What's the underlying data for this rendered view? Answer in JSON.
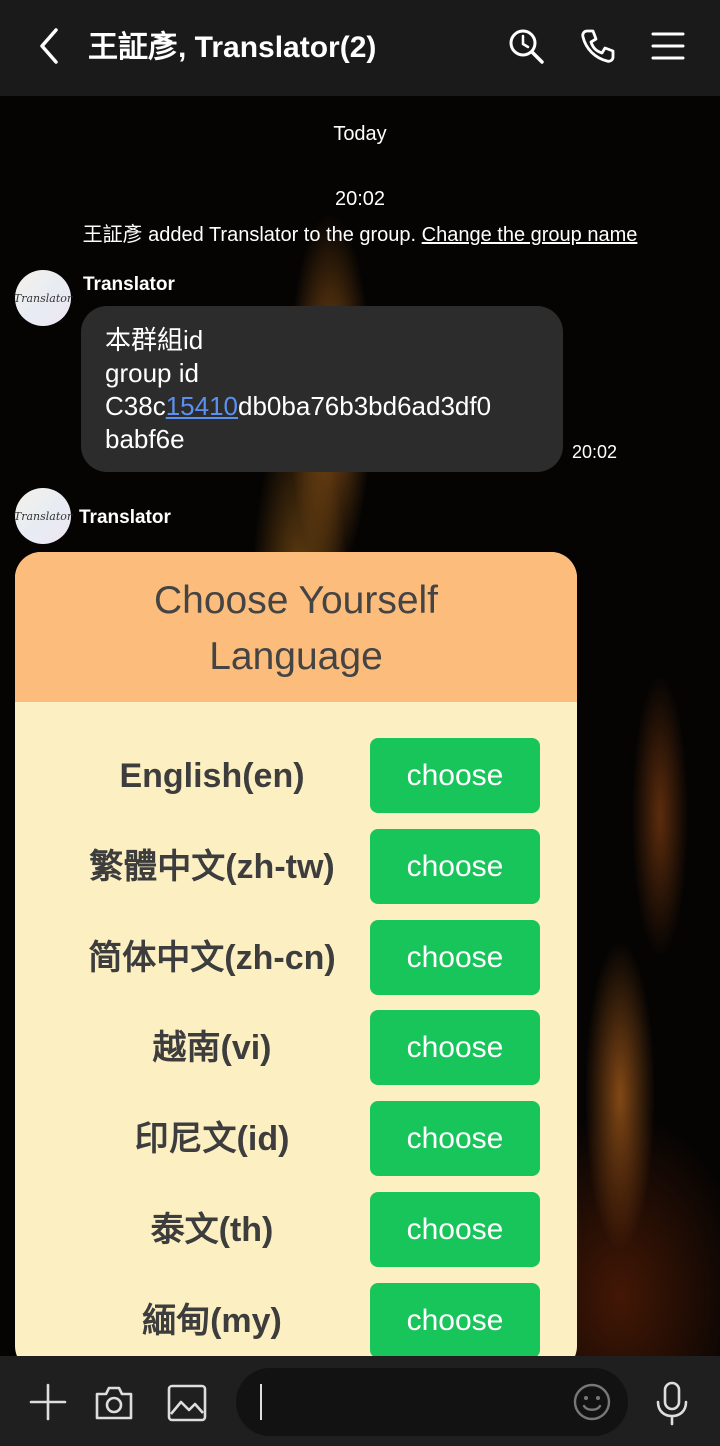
{
  "header": {
    "title": "王証彥, Translator(2)",
    "icons": [
      "back-icon",
      "search-icon",
      "call-icon",
      "menu-icon"
    ]
  },
  "system": {
    "date": "Today",
    "time": "20:02",
    "message": "王証彥 added Translator to the group.",
    "link": "Change the group name"
  },
  "messages": [
    {
      "sender": "Translator",
      "avatar_text": "Translator",
      "line1": "本群組id",
      "line2": "group id",
      "id_prefix": "C38c",
      "id_link": "15410",
      "id_suffix": "db0ba76b3bd6ad3df0",
      "line4": "babf6e",
      "time": "20:02"
    },
    {
      "sender": "Translator",
      "avatar_text": "Translator"
    }
  ],
  "card": {
    "title_line1": "Choose Yourself",
    "title_line2": "Language",
    "button_label": "choose",
    "languages": [
      "English(en)",
      "繁體中文(zh-tw)",
      "简体中文(zh-cn)",
      "越南(vi)",
      "印尼文(id)",
      "泰文(th)",
      "緬甸(my)"
    ]
  },
  "colors": {
    "header_bg": "#1a1a1a",
    "card_head": "#fcbd7c",
    "card_body": "#fcf0c3",
    "button": "#18c55a",
    "link": "#5b8ff0"
  },
  "input": {
    "value": ""
  }
}
